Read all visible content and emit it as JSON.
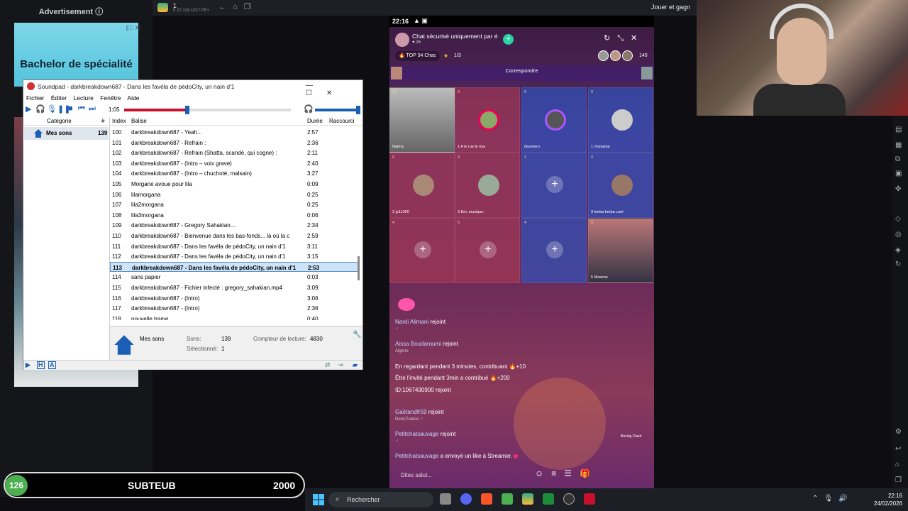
{
  "ad": {
    "label": "Advertisement ⓘ",
    "text": "Bachelor de spécialité",
    "badge": "[ⓘ X]"
  },
  "browser": {
    "tab_title": "1",
    "tab_sub": "5.22.118.1037 PB+",
    "game_link": "Jouer et gagn"
  },
  "soundpad": {
    "title": "Soundpad - darkbreakdown687 - Dans les favéla de pédoCity, un nain d'1",
    "menu": [
      "Fichier",
      "Éditer",
      "Lecture",
      "Fenêtre",
      "Aide"
    ],
    "time": "1:05",
    "progress": 0.38,
    "categories_header": {
      "name": "Catégorie",
      "count": "#"
    },
    "category": {
      "name": "Mes sons",
      "count": "139"
    },
    "list_header": {
      "index": "Index",
      "tag": "Balise",
      "duration": "Durée",
      "shortcut": "Raccourci"
    },
    "rows": [
      {
        "index": "100",
        "tag": "darkbreakdown687 - Yeah...",
        "duration": "2:57"
      },
      {
        "index": "101",
        "tag": "darkbreakdown687 - Refrain :",
        "duration": "2:36"
      },
      {
        "index": "102",
        "tag": "darkbreakdown687 - Refrain (Shatta, scandé, qui cogne) :",
        "duration": "2:11"
      },
      {
        "index": "103",
        "tag": "darkbreakdown687 - (Intro – voix grave)",
        "duration": "2:40"
      },
      {
        "index": "104",
        "tag": "darkbreakdown687 - (Intro – chuchoté, malsain)",
        "duration": "3:27"
      },
      {
        "index": "105",
        "tag": "Morgane avoue pour lila",
        "duration": "0:09"
      },
      {
        "index": "106",
        "tag": "lilamorgana",
        "duration": "0:25"
      },
      {
        "index": "107",
        "tag": "lila2morgana",
        "duration": "0:25"
      },
      {
        "index": "108",
        "tag": "lila3morgana",
        "duration": "0:06"
      },
      {
        "index": "109",
        "tag": "darkbreakdown687 - Gregory Sahakian...",
        "duration": "2:34"
      },
      {
        "index": "110",
        "tag": "darkbreakdown687 - Bienvenue dans les bas-fonds... là où la c",
        "duration": "2:59"
      },
      {
        "index": "111",
        "tag": "darkbreakdown687 - Dans les favéla de pédoCity, un nain d'1",
        "duration": "3:11"
      },
      {
        "index": "112",
        "tag": "darkbreakdown687 - Dans les favéla de pédoCity, un nain d'1",
        "duration": "3:15"
      },
      {
        "index": "113",
        "tag": "darkbreakdown687 - Dans les favéla de pédoCity, un nain d'1",
        "duration": "2:53",
        "selected": true
      },
      {
        "index": "114",
        "tag": "sans papier",
        "duration": "0:03"
      },
      {
        "index": "115",
        "tag": "darkbreakdown687 - Fichier infecté : gregory_sahakian.mp4",
        "duration": "3:09"
      },
      {
        "index": "116",
        "tag": "darkbreakdown687 - (Intro)",
        "duration": "3:06"
      },
      {
        "index": "117",
        "tag": "darkbreakdown687 - (Intro)",
        "duration": "2:36"
      },
      {
        "index": "118",
        "tag": "nouvelle trame",
        "duration": "0:40"
      }
    ],
    "info": {
      "name": "Mes sons",
      "sons_label": "Sons:",
      "sons_value": "139",
      "selected_label": "Sélectionné:",
      "selected_value": "1",
      "counter_label": "Compteur de lecture:",
      "counter_value": "4830"
    }
  },
  "phone": {
    "time": "22:16",
    "chat_title": "Chat sécurisé uniquement par é",
    "likes": "♥ 26",
    "top_label": "🔥 TOP 34 Chac",
    "guests": "1/3",
    "viewers": "140",
    "match_label": "Correspondre",
    "cells": [
      {
        "num": "16",
        "label": "Naima"
      },
      {
        "num": "0",
        "label": "1  A le rue le trav"
      },
      {
        "num": "0",
        "label": "Guerrero"
      },
      {
        "num": "0",
        "label": "1  nhyasina"
      },
      {
        "num": "0",
        "label": "2  jp11000"
      },
      {
        "num": "0",
        "label": "3  Eric musique."
      },
      {
        "num": "2",
        "label": ""
      },
      {
        "num": "0",
        "label": "3  kerba kerba curé"
      },
      {
        "num": "4",
        "label": ""
      },
      {
        "num": "5",
        "label": ""
      },
      {
        "num": "4",
        "label": ""
      },
      {
        "num": "0",
        "label": "5  Maxime"
      }
    ],
    "messages": [
      {
        "user": "Nardi Alimani",
        "text": " rejoint",
        "sub": "♂"
      },
      {
        "user": "Aissa Boudaroumi",
        "text": " rejoint",
        "sub": "Algérie"
      },
      {
        "user": "",
        "text": "En regardant pendant 3 minutes, contribuant 🔥+10",
        "sub": ""
      },
      {
        "user": "",
        "text": "Être l'invité pendant 3min a contribué 🔥+200",
        "sub": ""
      },
      {
        "user": "ID:1067430900",
        "text": " rejoint",
        "sub": ""
      },
      {
        "user": "Gaëtandfr59",
        "text": " rejoint",
        "sub": "Nord,France ♂"
      },
      {
        "user": "Petitchatsauvage",
        "text": " rejoint",
        "sub": "♂"
      },
      {
        "user": "Petitchatsauvage",
        "text": " a envoyé un like à Streamer.💗",
        "sub": ""
      }
    ],
    "input_placeholder": "Dites salut...",
    "boxing": "Boxing Clash"
  },
  "sub_bar": {
    "count": "126",
    "label": "SUBTEUB",
    "goal": "2000"
  },
  "taskbar": {
    "search": "Rechercher",
    "time": "22:16",
    "date": "24/02/2026"
  },
  "colors": {
    "accent": "#1a5fb4",
    "progress": "#c8102e",
    "selection": "#cde3f7"
  }
}
